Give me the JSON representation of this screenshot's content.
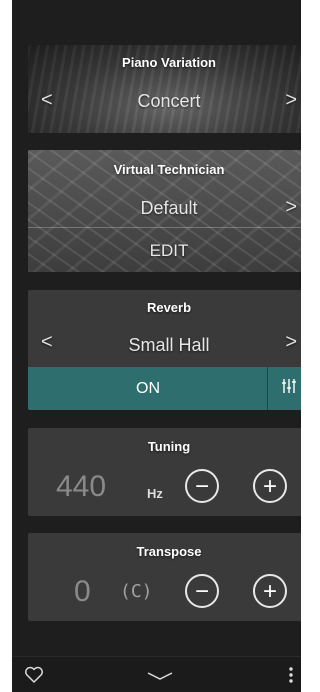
{
  "piano_variation": {
    "title": "Piano Variation",
    "value": "Concert",
    "prev": "<",
    "next": ">"
  },
  "virtual_technician": {
    "title": "Virtual Technician",
    "value": "Default",
    "next": ">",
    "edit_label": "EDIT"
  },
  "reverb": {
    "title": "Reverb",
    "value": "Small Hall",
    "prev": "<",
    "next": ">",
    "toggle_label": "ON"
  },
  "tuning": {
    "title": "Tuning",
    "value": "440",
    "unit": "Hz"
  },
  "transpose": {
    "title": "Transpose",
    "value": "0",
    "key": "(C)"
  },
  "icons": [
    "heart-icon",
    "chevron-down-icon",
    "more-vertical-icon",
    "equalizer-icon",
    "minus-icon",
    "plus-icon"
  ],
  "colors": {
    "accent": "#2f6e6e",
    "panel": "#1e1e1e",
    "card": "#3a3a3a"
  }
}
